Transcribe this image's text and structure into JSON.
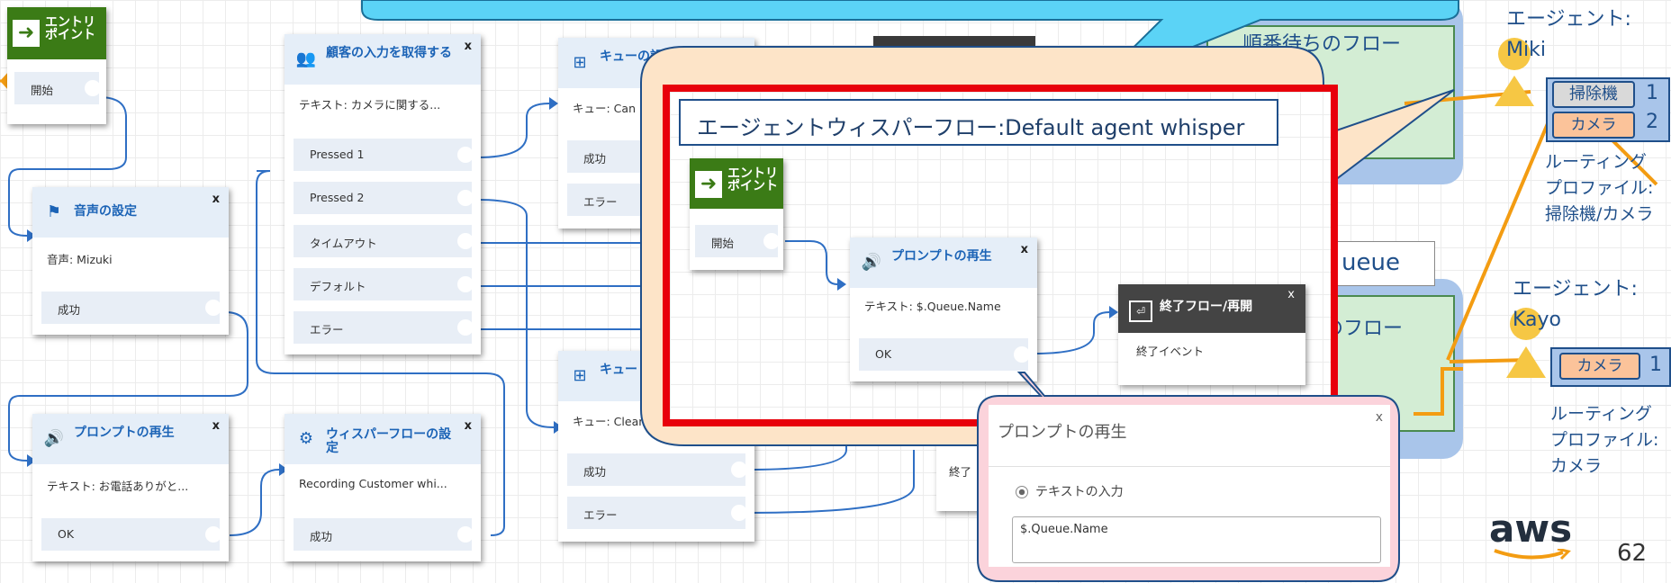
{
  "blocks": {
    "entry_main": {
      "title": "エントリポイント",
      "row": "開始"
    },
    "voice": {
      "title": "音声の設定",
      "desc": "音声: Mizuki",
      "rows": [
        "成功"
      ]
    },
    "prompt1": {
      "title": "プロンプトの再生",
      "desc": "テキスト: お電話ありがと...",
      "rows": [
        "OK"
      ]
    },
    "getinput": {
      "title": "顧客の入力を取得する",
      "desc": "テキスト: カメラに関する...",
      "rows": [
        "Pressed 1",
        "Pressed 2",
        "タイムアウト",
        "デフォルト",
        "エラー"
      ]
    },
    "whisperset": {
      "title": "ウィスパーフローの設定",
      "desc": "Recording Customer whi...",
      "rows": [
        "成功"
      ]
    },
    "queue1": {
      "title": "キューの設定",
      "desc": "キュー: Can",
      "rows": [
        "成功",
        "エラー"
      ]
    },
    "queue2": {
      "title": "キュー",
      "desc": "キュー: Clean",
      "rows": [
        "成功",
        "エラー"
      ]
    },
    "hidden_partial": {
      "desc": "終了"
    }
  },
  "close_glyph": "x",
  "callout": {
    "title": "エージェントウィスパーフロー:Default agent whisper",
    "entry": {
      "title": "エントリポイント",
      "row": "開始"
    },
    "prompt": {
      "title": "プロンプトの再生",
      "desc": "テキスト: $.Queue.Name",
      "row": "OK"
    },
    "end": {
      "title": "終了フロー/再開",
      "desc": "終了イベント"
    }
  },
  "popup": {
    "title": "プロンプトの再生",
    "close": "x",
    "radio_label": "テキストの入力",
    "input_value": "$.Queue.Name"
  },
  "slide": {
    "flow1_label": "順番待ちのフロー",
    "flow2_label": "のフロー",
    "queue_label": "ueue",
    "agent1": {
      "label": "エージェント:",
      "name": "Miki",
      "skills": [
        {
          "name": "掃除機",
          "level": "1"
        },
        {
          "name": "カメラ",
          "level": "2"
        }
      ],
      "profile": [
        "ルーティング",
        "プロファイル:",
        "掃除機/カメラ"
      ]
    },
    "agent2": {
      "label": "エージェント:",
      "name": "Kayo",
      "skills": [
        {
          "name": "カメラ",
          "level": "1"
        }
      ],
      "profile": [
        "ルーティング",
        "プロファイル:",
        "カメラ"
      ]
    },
    "logo": "aws",
    "page": "62"
  },
  "colors": {
    "connector": "#2f6fc4",
    "accent": "#f39c12",
    "callout_red": "#e8000b",
    "block_title": "#1b63b6",
    "entry_green": "#3b7b16"
  }
}
